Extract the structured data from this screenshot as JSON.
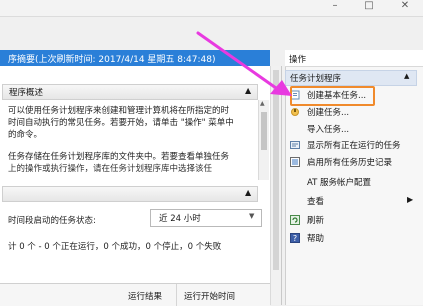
{
  "window": {
    "minimize_glyph": "–",
    "maximize_glyph": "□",
    "close_glyph": "✕"
  },
  "summary": {
    "header_text": "序摘要(上次刷新时间: 2017/4/14 星期五 8:47:48)",
    "overview_title": "程序概述",
    "overview_lines": [
      "可以使用任务计划程序来创建和管理计算机将在所指定的时",
      "时间自动执行的常见任务。若要开始，请单击 \"操作\" 菜单中",
      "的命令。",
      "",
      "任务存储在任务计划程序库的文件夹中。若要查看单独任务",
      "上的操作或执行操作，请在任务计划程序库中选择该任"
    ],
    "status_label": "时间段启动的任务状态:",
    "status_select": "近 24 小时",
    "status_summary": "计 0 个 - 0 个正在运行，0 个成功，0 个停止，0 个失败",
    "table_columns": [
      "运行结果",
      "运行开始时间"
    ]
  },
  "actions": {
    "header": "操作",
    "group_title": "任务计划程序",
    "items": [
      {
        "label": "创建基本任务...",
        "icon": "create-basic-task-icon"
      },
      {
        "label": "创建任务...",
        "icon": "create-task-icon"
      },
      {
        "label": "导入任务...",
        "icon": ""
      },
      {
        "label": "显示所有正在运行的任务",
        "icon": "running-tasks-icon"
      },
      {
        "label": "启用所有任务历史记录",
        "icon": "history-icon"
      },
      {
        "label": "AT 服务帐户配置",
        "icon": ""
      },
      {
        "label": "查看",
        "icon": ""
      },
      {
        "label": "刷新",
        "icon": "refresh-icon"
      },
      {
        "label": "帮助",
        "icon": "help-icon"
      }
    ]
  },
  "colors": {
    "summary_bar": "#2a7fd8",
    "highlight_border": "#f08a2c",
    "arrow": "#e83ae0"
  }
}
